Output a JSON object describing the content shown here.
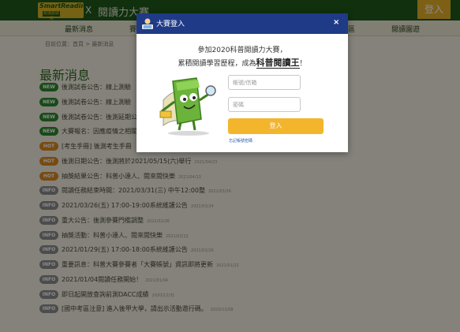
{
  "header": {
    "logo_top": "SmartReading",
    "logo_bottom": "越讀越聰明",
    "logo_x": "X",
    "site_title": "閱讀力大賽",
    "login_button": "登入"
  },
  "nav": {
    "items": [
      {
        "label": "最新消息"
      },
      {
        "label": "賽"
      },
      {
        "label": "區"
      },
      {
        "label": "閱讀園遊"
      }
    ]
  },
  "breadcrumb": "目前位置：首頁 > 最新消息",
  "news": {
    "title": "最新消息",
    "items": [
      {
        "badge": "NEW",
        "text": "後測試卷公告：線上測驗"
      },
      {
        "badge": "NEW",
        "text": "後測試卷公告：線上測驗"
      },
      {
        "badge": "NEW",
        "text": "後測試卷公告：後測延期公"
      },
      {
        "badge": "NEW",
        "text": "大賽報名：因應疫情之相關"
      },
      {
        "badge": "HOT",
        "text": "[考生手冊] 後測考生手冊"
      },
      {
        "badge": "HOT",
        "text": "後測日期公告：後測將於2021/05/15(六)舉行",
        "date": "2021/04/23"
      },
      {
        "badge": "HOT",
        "text": "抽獎結果公告：科普小達人、閱來閱快樂",
        "date": "2021/04/13"
      },
      {
        "badge": "INFO",
        "text": "閱讀任務結束時間：2021/03/31(三) 中午12:00整",
        "date": "2021/03/26"
      },
      {
        "badge": "INFO",
        "text": "2021/03/26(五) 17:00-19:00系統維護公告",
        "date": "2021/03/24"
      },
      {
        "badge": "INFO",
        "text": "重大公告：後測參賽門檻調整",
        "date": "2021/02/26"
      },
      {
        "badge": "INFO",
        "text": "抽獎活動：科普小達人、閱來閱快樂",
        "date": "2021/02/22"
      },
      {
        "badge": "INFO",
        "text": "2021/01/29(五) 17:00-18:00系統維護公告",
        "date": "2021/01/26"
      },
      {
        "badge": "INFO",
        "text": "重要訊息：科普大賽參賽者「大賽帳號」資訊即將更新",
        "date": "2021/01/22"
      },
      {
        "badge": "INFO",
        "text": "2021/01/04閱讀任務開始！",
        "date": "2021/01/04"
      },
      {
        "badge": "INFO",
        "text": "即日起開放查詢前測DACC成績",
        "date": "2020/12/31"
      },
      {
        "badge": "INFO",
        "text": "[國中考區注意] 進入後甲大學，請出示活動邀行碼。",
        "date": "2020/12/08"
      }
    ]
  },
  "modal": {
    "title": "大賽登入",
    "close": "×",
    "intro_line1": "參加2020科普閱讀力大賽，",
    "intro_line2_prefix": "累積閱讀學習歷程，成為",
    "intro_line2_strong": "科普閱讀王",
    "intro_line2_suffix": "！",
    "username_placeholder": "帳號/信箱",
    "password_placeholder": "密碼",
    "submit": "登入",
    "forgot": "忘記帳號密碼"
  },
  "colors": {
    "header": "#1f5a1a",
    "modal_header": "#1f3a87",
    "submit": "#f3b52b",
    "badge_new": "#2e8b2e",
    "badge_hot": "#e08a1e",
    "badge_info": "#8c8c8c"
  }
}
